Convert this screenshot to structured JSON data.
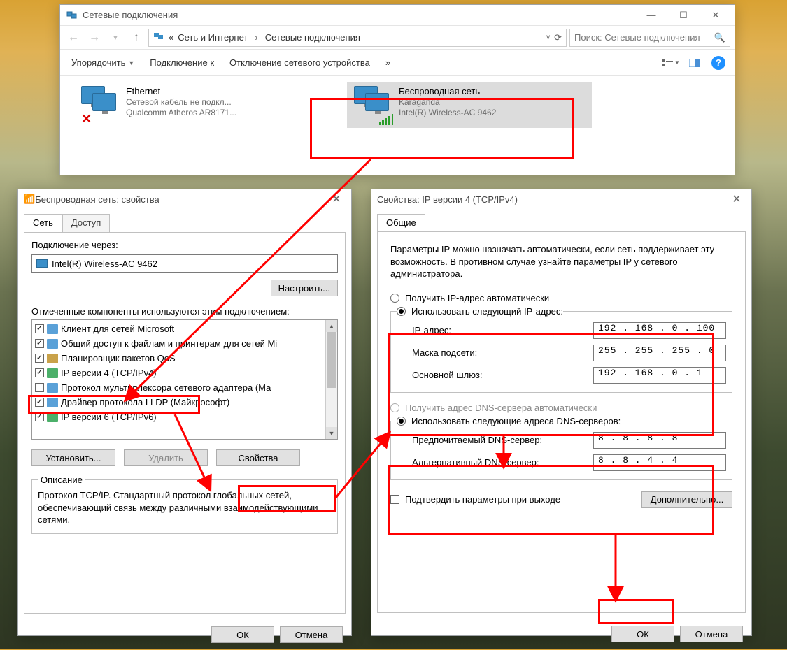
{
  "explorer": {
    "title": "Сетевые подключения",
    "breadcrumb_prefix": "«",
    "breadcrumb_1": "Сеть и Интернет",
    "breadcrumb_2": "Сетевые подключения",
    "search_placeholder": "Поиск: Сетевые подключения",
    "toolbar": {
      "organize": "Упорядочить",
      "connect_to": "Подключение к",
      "disable_device": "Отключение сетевого устройства",
      "more": "»"
    },
    "connections": {
      "ethernet": {
        "title": "Ethernet",
        "status": "Сетевой кабель не подкл...",
        "device": "Qualcomm Atheros AR8171..."
      },
      "wifi": {
        "title": "Беспроводная сеть",
        "status": "Karaganda",
        "device": "Intel(R) Wireless-AC 9462"
      }
    }
  },
  "wifi_props": {
    "title": "Беспроводная сеть: свойства",
    "tab_network": "Сеть",
    "tab_access": "Доступ",
    "connect_via_label": "Подключение через:",
    "adapter": "Intel(R) Wireless-AC 9462",
    "configure": "Настроить...",
    "components_label": "Отмеченные компоненты используются этим подключением:",
    "components": [
      {
        "checked": true,
        "text": "Клиент для сетей Microsoft"
      },
      {
        "checked": true,
        "text": "Общий доступ к файлам и принтерам для сетей Mi"
      },
      {
        "checked": true,
        "text": "Планировщик пакетов QoS"
      },
      {
        "checked": true,
        "text": "IP версии 4 (TCP/IPv4)"
      },
      {
        "checked": false,
        "text": "Протокол мультиплексора сетевого адаптера (Ма"
      },
      {
        "checked": true,
        "text": "Драйвер протокола LLDP (Майкрософт)"
      },
      {
        "checked": true,
        "text": "IP версии 6 (TCP/IPv6)"
      }
    ],
    "install": "Установить...",
    "remove": "Удалить",
    "properties": "Свойства",
    "desc_legend": "Описание",
    "desc_text": "Протокол TCP/IP. Стандартный протокол глобальных сетей, обеспечивающий связь между различными взаимодействующими сетями.",
    "ok": "ОК",
    "cancel": "Отмена"
  },
  "ipv4": {
    "title": "Свойства: IP версии 4 (TCP/IPv4)",
    "tab_general": "Общие",
    "intro": "Параметры IP можно назначать автоматически, если сеть поддерживает эту возможность. В противном случае узнайте параметры IP у сетевого администратора.",
    "auto_ip": "Получить IP-адрес автоматически",
    "manual_ip": "Использовать следующий IP-адрес:",
    "ip_label": "IP-адрес:",
    "mask_label": "Маска подсети:",
    "gw_label": "Основной шлюз:",
    "ip": "192 . 168 .  0  . 100",
    "mask": "255 . 255 . 255 .  0",
    "gw": "192 . 168 .  0  .  1",
    "auto_dns": "Получить адрес DNS-сервера автоматически",
    "manual_dns": "Использовать следующие адреса DNS-серверов:",
    "dns1_label": "Предпочитаемый DNS-сервер:",
    "dns2_label": "Альтернативный DNS-сервер:",
    "dns1": " 8  .  8  .  8  .  8",
    "dns2": " 8  .  8  .  4  .  4",
    "confirm_on_exit": "Подтвердить параметры при выходе",
    "advanced": "Дополнительно...",
    "ok": "ОК",
    "cancel": "Отмена"
  }
}
